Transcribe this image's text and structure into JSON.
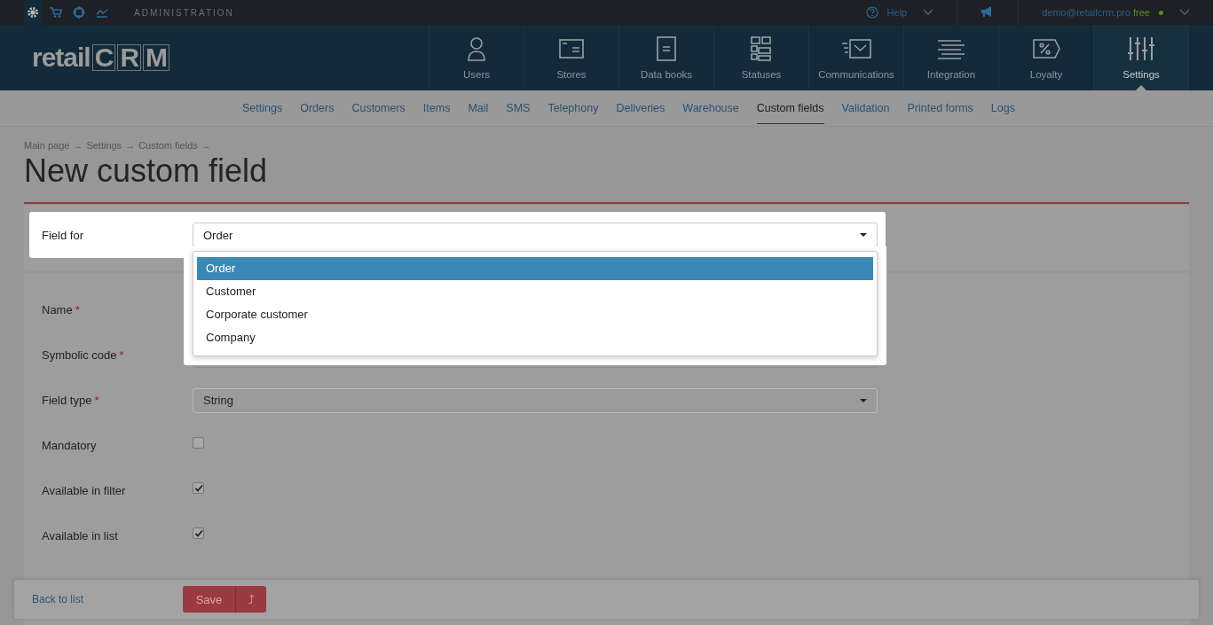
{
  "topbar": {
    "section": "ADMINISTRATION",
    "help": "Help",
    "email": "demo@retailcrm.pro",
    "plan": "free"
  },
  "logo": {
    "text": "retail",
    "letters": [
      "C",
      "R",
      "M"
    ]
  },
  "nav": [
    {
      "label": "Users",
      "selected": false
    },
    {
      "label": "Stores",
      "selected": false
    },
    {
      "label": "Data books",
      "selected": false
    },
    {
      "label": "Statuses",
      "selected": false
    },
    {
      "label": "Communications",
      "selected": false
    },
    {
      "label": "Integration",
      "selected": false
    },
    {
      "label": "Loyalty",
      "selected": false
    },
    {
      "label": "Settings",
      "selected": true
    }
  ],
  "subnav": [
    {
      "label": "Settings",
      "selected": false
    },
    {
      "label": "Orders",
      "selected": false
    },
    {
      "label": "Customers",
      "selected": false
    },
    {
      "label": "Items",
      "selected": false
    },
    {
      "label": "Mail",
      "selected": false
    },
    {
      "label": "SMS",
      "selected": false
    },
    {
      "label": "Telephony",
      "selected": false
    },
    {
      "label": "Deliveries",
      "selected": false
    },
    {
      "label": "Warehouse",
      "selected": false
    },
    {
      "label": "Custom fields",
      "selected": true
    },
    {
      "label": "Validation",
      "selected": false
    },
    {
      "label": "Printed forms",
      "selected": false
    },
    {
      "label": "Logs",
      "selected": false
    }
  ],
  "breadcrumb": [
    "Main page",
    "Settings",
    "Custom fields"
  ],
  "breadcrumb_sep": "→",
  "title": "New custom field",
  "field_for": {
    "label": "Field for",
    "value": "Order",
    "options": [
      {
        "label": "Order",
        "selected": true
      },
      {
        "label": "Customer",
        "selected": false
      },
      {
        "label": "Corporate customer",
        "selected": false
      },
      {
        "label": "Company",
        "selected": false
      }
    ]
  },
  "required_mark": "*",
  "rows": [
    {
      "label": "Name",
      "kind": "label",
      "required": true
    },
    {
      "label": "Symbolic code",
      "kind": "input",
      "required": true
    },
    {
      "label": "Field type",
      "kind": "select",
      "required": true,
      "value": "String"
    },
    {
      "label": "Mandatory",
      "kind": "checkbox",
      "required": false,
      "checked": false
    },
    {
      "label": "Available in filter",
      "kind": "checkbox",
      "required": false,
      "checked": true
    },
    {
      "label": "Available in list",
      "kind": "checkbox",
      "required": false,
      "checked": true
    }
  ],
  "footer": {
    "back": "Back to list",
    "save": "Save",
    "arrow": "⤴"
  }
}
